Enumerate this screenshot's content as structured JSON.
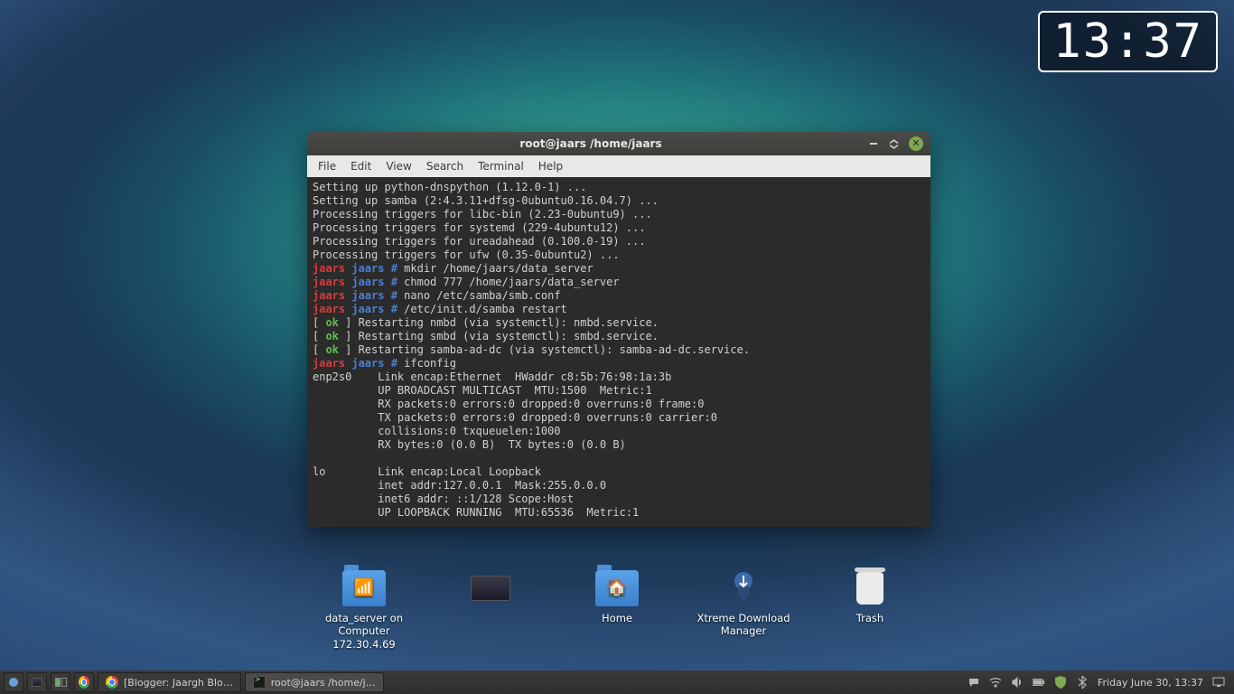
{
  "clock": {
    "time": "13:37"
  },
  "terminal": {
    "title": "root@jaars /home/jaars",
    "menu": [
      "File",
      "Edit",
      "View",
      "Search",
      "Terminal",
      "Help"
    ],
    "lines": [
      [
        {
          "t": "Setting up python-dnspython (1.12.0-1) ..."
        }
      ],
      [
        {
          "t": "Setting up samba (2:4.3.11+dfsg-0ubuntu0.16.04.7) ..."
        }
      ],
      [
        {
          "t": "Processing triggers for libc-bin (2.23-0ubuntu9) ..."
        }
      ],
      [
        {
          "t": "Processing triggers for systemd (229-4ubuntu12) ..."
        }
      ],
      [
        {
          "t": "Processing triggers for ureadahead (0.100.0-19) ..."
        }
      ],
      [
        {
          "t": "Processing triggers for ufw (0.35-0ubuntu2) ..."
        }
      ],
      [
        {
          "c": "red",
          "t": "jaars"
        },
        {
          "t": " "
        },
        {
          "c": "blue",
          "t": "jaars #"
        },
        {
          "t": " mkdir /home/jaars/data_server"
        }
      ],
      [
        {
          "c": "red",
          "t": "jaars"
        },
        {
          "t": " "
        },
        {
          "c": "blue",
          "t": "jaars #"
        },
        {
          "t": " chmod 777 /home/jaars/data_server"
        }
      ],
      [
        {
          "c": "red",
          "t": "jaars"
        },
        {
          "t": " "
        },
        {
          "c": "blue",
          "t": "jaars #"
        },
        {
          "t": " nano /etc/samba/smb.conf"
        }
      ],
      [
        {
          "c": "red",
          "t": "jaars"
        },
        {
          "t": " "
        },
        {
          "c": "blue",
          "t": "jaars #"
        },
        {
          "t": " /etc/init.d/samba restart"
        }
      ],
      [
        {
          "t": "[ "
        },
        {
          "c": "green",
          "t": "ok"
        },
        {
          "t": " ] Restarting nmbd (via systemctl): nmbd.service."
        }
      ],
      [
        {
          "t": "[ "
        },
        {
          "c": "green",
          "t": "ok"
        },
        {
          "t": " ] Restarting smbd (via systemctl): smbd.service."
        }
      ],
      [
        {
          "t": "[ "
        },
        {
          "c": "green",
          "t": "ok"
        },
        {
          "t": " ] Restarting samba-ad-dc (via systemctl): samba-ad-dc.service."
        }
      ],
      [
        {
          "c": "red",
          "t": "jaars"
        },
        {
          "t": " "
        },
        {
          "c": "blue",
          "t": "jaars #"
        },
        {
          "t": " ifconfig"
        }
      ],
      [
        {
          "t": "enp2s0    Link encap:Ethernet  HWaddr c8:5b:76:98:1a:3b"
        }
      ],
      [
        {
          "t": "          UP BROADCAST MULTICAST  MTU:1500  Metric:1"
        }
      ],
      [
        {
          "t": "          RX packets:0 errors:0 dropped:0 overruns:0 frame:0"
        }
      ],
      [
        {
          "t": "          TX packets:0 errors:0 dropped:0 overruns:0 carrier:0"
        }
      ],
      [
        {
          "t": "          collisions:0 txqueuelen:1000"
        }
      ],
      [
        {
          "t": "          RX bytes:0 (0.0 B)  TX bytes:0 (0.0 B)"
        }
      ],
      [
        {
          "t": ""
        }
      ],
      [
        {
          "t": "lo        Link encap:Local Loopback"
        }
      ],
      [
        {
          "t": "          inet addr:127.0.0.1  Mask:255.0.0.0"
        }
      ],
      [
        {
          "t": "          inet6 addr: ::1/128 Scope:Host"
        }
      ],
      [
        {
          "t": "          UP LOOPBACK RUNNING  MTU:65536  Metric:1"
        }
      ]
    ]
  },
  "desktop_icons": [
    {
      "id": "data-server-share",
      "label": "data_server on Computer 172.30.4.69",
      "kind": "network-folder"
    },
    {
      "id": "generic-app",
      "label": "",
      "kind": "desktop"
    },
    {
      "id": "home-folder",
      "label": "Home",
      "kind": "home-folder"
    },
    {
      "id": "xtreme-download-manager",
      "label": "Xtreme Download Manager",
      "kind": "xdm"
    },
    {
      "id": "trash",
      "label": "Trash",
      "kind": "trash"
    }
  ],
  "taskbar": {
    "tasks": [
      {
        "icon": "chrome",
        "label": "[Blogger: Jaargh Blo…"
      },
      {
        "icon": "terminal",
        "label": "root@jaars /home/j…"
      }
    ],
    "datetime": "Friday June 30, 13:37"
  }
}
